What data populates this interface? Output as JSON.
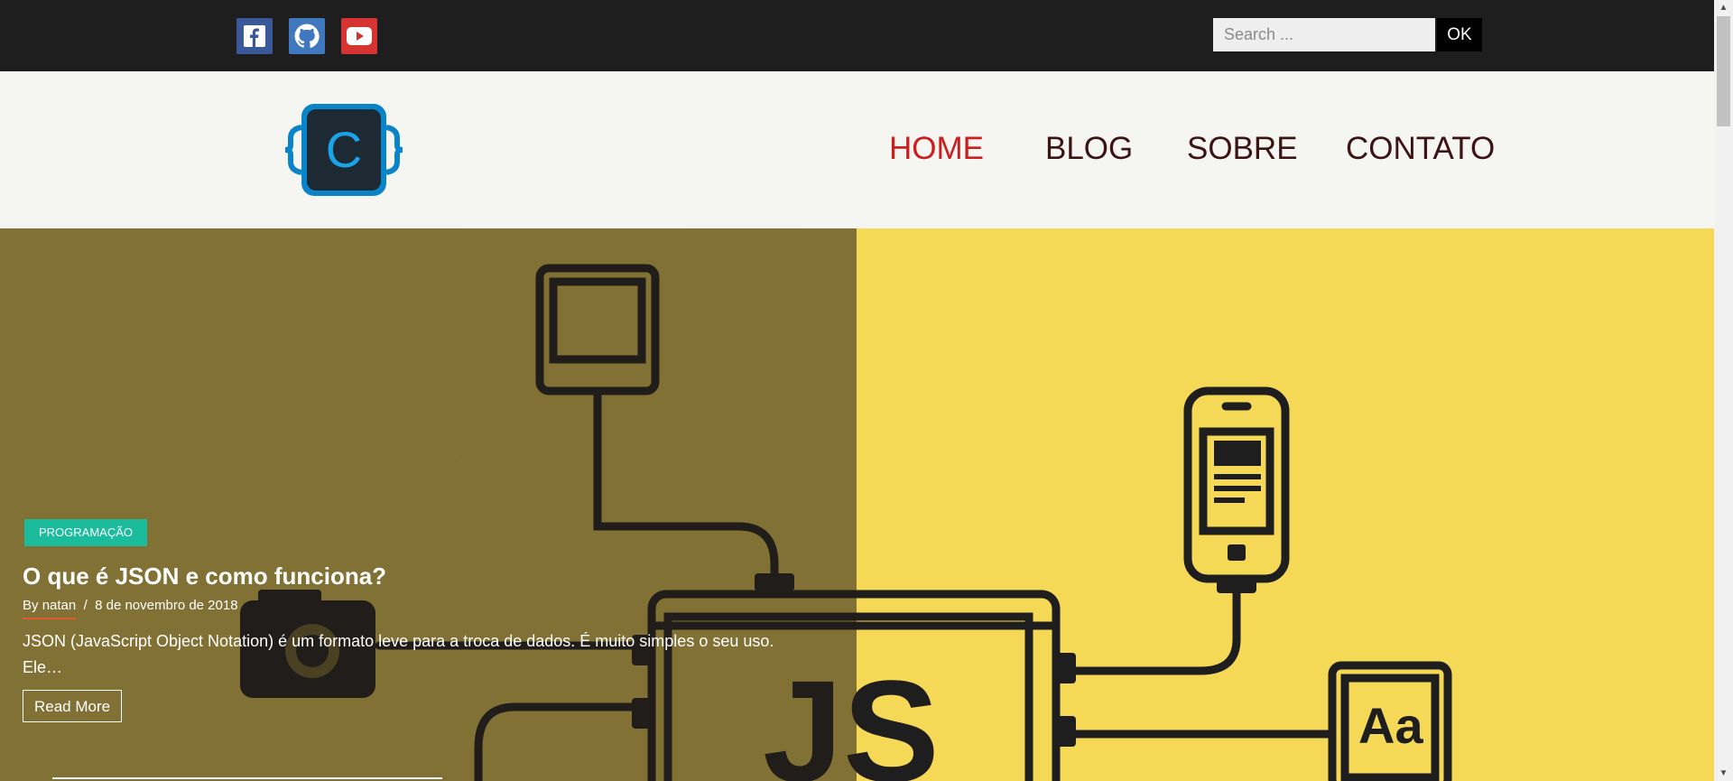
{
  "social": {
    "facebook_icon": "facebook-icon",
    "github_icon": "github-icon",
    "youtube_icon": "youtube-icon"
  },
  "search": {
    "placeholder": "Search ...",
    "value": "",
    "button_label": "OK"
  },
  "logo": {
    "letter": "C"
  },
  "nav": {
    "items": [
      {
        "label": "HOME",
        "active": true
      },
      {
        "label": "BLOG",
        "active": false
      },
      {
        "label": "SOBRE",
        "active": false
      },
      {
        "label": "CONTATO",
        "active": false
      }
    ]
  },
  "hero": {
    "category": "PROGRAMAÇÃO",
    "title": "O que é JSON e como funciona?",
    "author_prefix": "By",
    "author": "natan",
    "separator": "/",
    "date": "8 de novembro de 2018",
    "excerpt": "JSON (JavaScript Object Notation) é um formato leve para a troca de dados. É muito simples o seu uso. Ele…",
    "read_more": "Read More",
    "image_text_js": "JS",
    "image_text_aa": "Aa"
  },
  "colors": {
    "topbar": "#1f1e1e",
    "accent_red": "#cc1e1e",
    "badge": "#1abc9c",
    "hero_bg": "#f6d857"
  }
}
